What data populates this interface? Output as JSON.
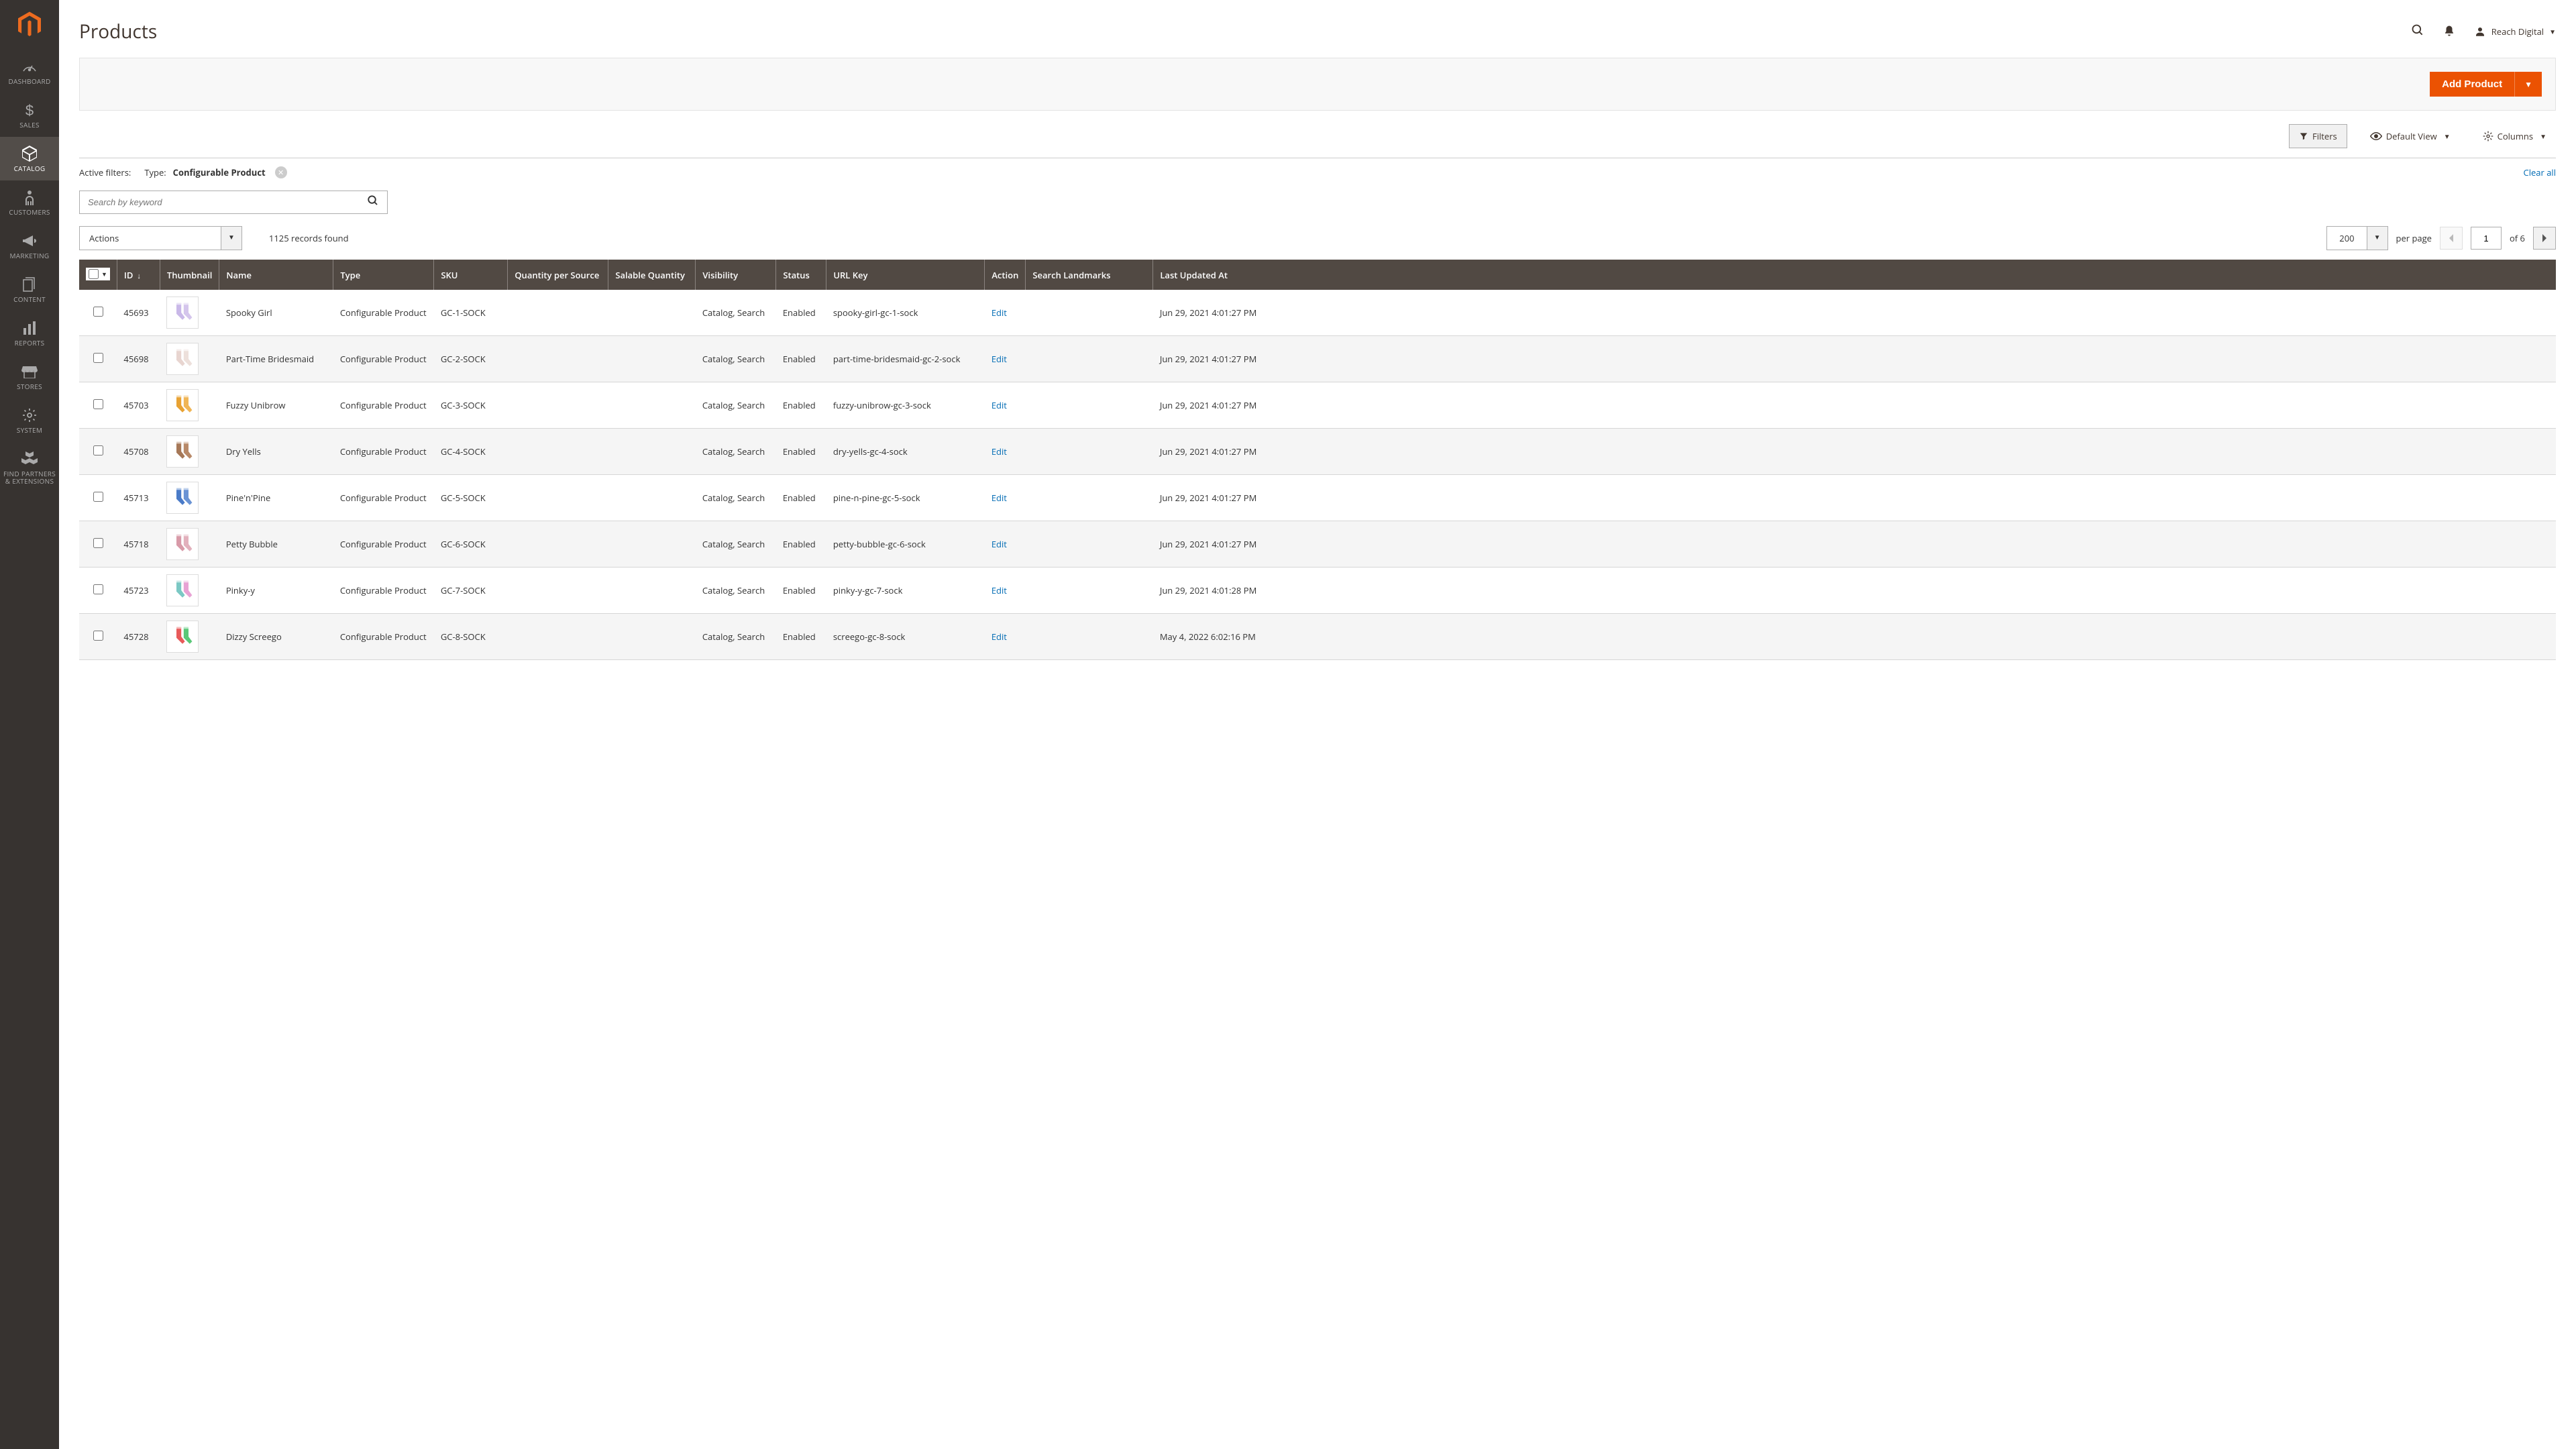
{
  "page": {
    "title": "Products"
  },
  "user": {
    "name": "Reach Digital"
  },
  "sidebar": {
    "items": [
      {
        "label": "DASHBOARD",
        "icon": "gauge"
      },
      {
        "label": "SALES",
        "icon": "dollar"
      },
      {
        "label": "CATALOG",
        "icon": "cube",
        "active": true
      },
      {
        "label": "CUSTOMERS",
        "icon": "person"
      },
      {
        "label": "MARKETING",
        "icon": "megaphone"
      },
      {
        "label": "CONTENT",
        "icon": "pages"
      },
      {
        "label": "REPORTS",
        "icon": "chart"
      },
      {
        "label": "STORES",
        "icon": "store"
      },
      {
        "label": "SYSTEM",
        "icon": "gear"
      },
      {
        "label": "FIND PARTNERS & EXTENSIONS",
        "icon": "partners"
      }
    ]
  },
  "actions": {
    "add_product": "Add Product"
  },
  "toolbar": {
    "filters": "Filters",
    "default_view": "Default View",
    "columns": "Columns"
  },
  "filters": {
    "active_label": "Active filters:",
    "chip_label": "Type:",
    "chip_value": "Configurable Product",
    "clear_all": "Clear all"
  },
  "search": {
    "placeholder": "Search by keyword"
  },
  "controls": {
    "actions_label": "Actions",
    "records_found": "1125 records found",
    "per_page_value": "200",
    "per_page_label": "per page",
    "current_page": "1",
    "total_pages_label": "of 6"
  },
  "columns": {
    "id": "ID",
    "thumbnail": "Thumbnail",
    "name": "Name",
    "type": "Type",
    "sku": "SKU",
    "qty_per_source": "Quantity per Source",
    "salable_qty": "Salable Quantity",
    "visibility": "Visibility",
    "status": "Status",
    "url_key": "URL Key",
    "action": "Action",
    "search_landmarks": "Search Landmarks",
    "last_updated": "Last Updated At"
  },
  "rows": [
    {
      "id": "45693",
      "name": "Spooky Girl",
      "type": "Configurable Product",
      "sku": "GC-1-SOCK",
      "visibility": "Catalog, Search",
      "status": "Enabled",
      "url_key": "spooky-girl-gc-1-sock",
      "action": "Edit",
      "updated": "Jun 29, 2021 4:01:27 PM",
      "sock_colors": [
        "#c9b8e8",
        "#d4c5ec"
      ]
    },
    {
      "id": "45698",
      "name": "Part-Time Bridesmaid",
      "type": "Configurable Product",
      "sku": "GC-2-SOCK",
      "visibility": "Catalog, Search",
      "status": "Enabled",
      "url_key": "part-time-bridesmaid-gc-2-sock",
      "action": "Edit",
      "updated": "Jun 29, 2021 4:01:27 PM",
      "sock_colors": [
        "#e8d5d0",
        "#ede0db"
      ]
    },
    {
      "id": "45703",
      "name": "Fuzzy Unibrow",
      "type": "Configurable Product",
      "sku": "GC-3-SOCK",
      "visibility": "Catalog, Search",
      "status": "Enabled",
      "url_key": "fuzzy-unibrow-gc-3-sock",
      "action": "Edit",
      "updated": "Jun 29, 2021 4:01:27 PM",
      "sock_colors": [
        "#e8a233",
        "#f0b555"
      ]
    },
    {
      "id": "45708",
      "name": "Dry Yells",
      "type": "Configurable Product",
      "sku": "GC-4-SOCK",
      "visibility": "Catalog, Search",
      "status": "Enabled",
      "url_key": "dry-yells-gc-4-sock",
      "action": "Edit",
      "updated": "Jun 29, 2021 4:01:27 PM",
      "sock_colors": [
        "#a67858",
        "#b88968"
      ]
    },
    {
      "id": "45713",
      "name": "Pine'n'Pine",
      "type": "Configurable Product",
      "sku": "GC-5-SOCK",
      "visibility": "Catalog, Search",
      "status": "Enabled",
      "url_key": "pine-n-pine-gc-5-sock",
      "action": "Edit",
      "updated": "Jun 29, 2021 4:01:27 PM",
      "sock_colors": [
        "#4a7bc8",
        "#6a93d4"
      ]
    },
    {
      "id": "45718",
      "name": "Petty Bubble",
      "type": "Configurable Product",
      "sku": "GC-6-SOCK",
      "visibility": "Catalog, Search",
      "status": "Enabled",
      "url_key": "petty-bubble-gc-6-sock",
      "action": "Edit",
      "updated": "Jun 29, 2021 4:01:27 PM",
      "sock_colors": [
        "#d89aa8",
        "#e2b0bc"
      ]
    },
    {
      "id": "45723",
      "name": "Pinky-y",
      "type": "Configurable Product",
      "sku": "GC-7-SOCK",
      "visibility": "Catalog, Search",
      "status": "Enabled",
      "url_key": "pinky-y-gc-7-sock",
      "action": "Edit",
      "updated": "Jun 29, 2021 4:01:28 PM",
      "sock_colors": [
        "#7bc8c4",
        "#e8a2d4"
      ]
    },
    {
      "id": "45728",
      "name": "Dizzy Screego",
      "type": "Configurable Product",
      "sku": "GC-8-SOCK",
      "visibility": "Catalog, Search",
      "status": "Enabled",
      "url_key": "screego-gc-8-sock",
      "action": "Edit",
      "updated": "May 4, 2022 6:02:16 PM",
      "sock_colors": [
        "#e85a5a",
        "#5ac878"
      ]
    }
  ]
}
